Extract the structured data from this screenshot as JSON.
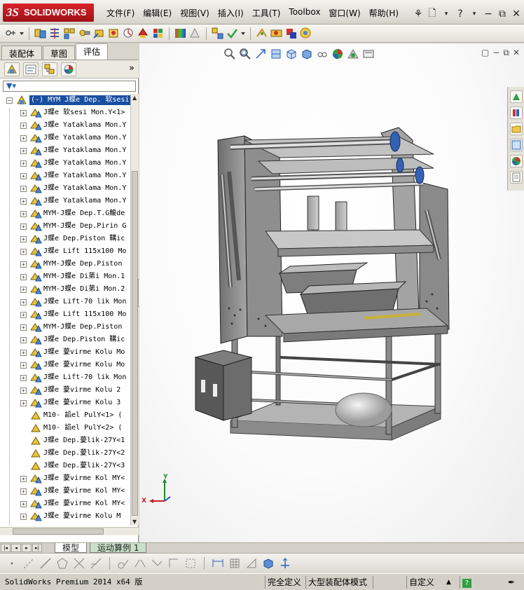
{
  "app": {
    "brand": "SOLIDWORKS",
    "brand_prefix": "3S"
  },
  "menubar": {
    "items": [
      "文件(F)",
      "编辑(E)",
      "视图(V)",
      "插入(I)",
      "工具(T)",
      "Toolbox",
      "窗口(W)",
      "帮助(H)"
    ]
  },
  "left_panel": {
    "tabs": [
      "装配体",
      "草图",
      "评估"
    ],
    "active_tab": "评估",
    "filter_icon": "filter-icon",
    "tree": {
      "root": "(-) MYM J蝶e Dep. 软sesi",
      "items": [
        "J蝶e 软sesi Mon.Y<1>",
        "J蝶e Yataklama Mon.Y",
        "J蝶e Yataklama Mon.Y",
        "J蝶e Yataklama Mon.Y",
        "J蝶e Yataklama Mon.Y",
        "J蝶e Yataklama Mon.Y",
        "J蝶e Yataklama Mon.Y",
        "J蝶e Yataklama Mon.Y",
        "MYM-J蝶e Dep.T.G鰒de",
        "MYM-J蝶e Dep.Pirin G",
        "J蝶e Dep.Piston 鞲ic",
        "J蝶e Lift 115x100 Mo",
        "MYM-J蝶e Dep.Piston",
        "MYM-J蝶e Di苐i Mon.1",
        "MYM-J蝶e Di苐i Mon.2",
        "J蝶e Lift-70 lik Mon",
        "J蝶e Lift 115x100 Mo",
        "MYM-J蝶e Dep.Piston",
        "J蝶e Dep.Piston 鞲ic",
        "J蝶e 薆virme Kolu Mo",
        "J蝶e 薆virme Kolu Mo",
        "J蝶e Lift-70 lik Mon",
        "J蝶e 薆virme Kolu 2",
        "J蝶e 薆virme Kolu 3",
        "M10- 諂el PulY<1> (",
        "M10- 諂el PulY<2> (",
        "J蝶e Dep.薆lik-27Y<1",
        "J蝶e Dep.薆lik-27Y<2",
        "J蝶e Dep.薆lik-27Y<3",
        "J蝶e 薆virme Kol MY<",
        "J蝶e 薆virme Kol MY<",
        "J蝶e 薆virme Kol MY<",
        "J蝶e 薆virme Kolu M"
      ],
      "item_expand": [
        true,
        true,
        true,
        true,
        true,
        true,
        true,
        true,
        true,
        true,
        true,
        true,
        true,
        true,
        true,
        true,
        true,
        true,
        true,
        true,
        true,
        true,
        true,
        true,
        false,
        false,
        false,
        false,
        false,
        true,
        true,
        true,
        true
      ]
    }
  },
  "graphics": {
    "triad": {
      "x": "X",
      "y": "Y"
    }
  },
  "bottom_tabs": {
    "items": [
      "模型",
      "运动算例 1"
    ],
    "active": "模型"
  },
  "statusbar": {
    "product": "SolidWorks Premium 2014 x64 版",
    "state": "完全定义",
    "mode": "大型装配体模式",
    "units": "自定义",
    "help_icon": "?"
  },
  "colors": {
    "selection": "#1a4fa0",
    "brand_red": "#c41c22",
    "frame": "#8c8c8c"
  }
}
